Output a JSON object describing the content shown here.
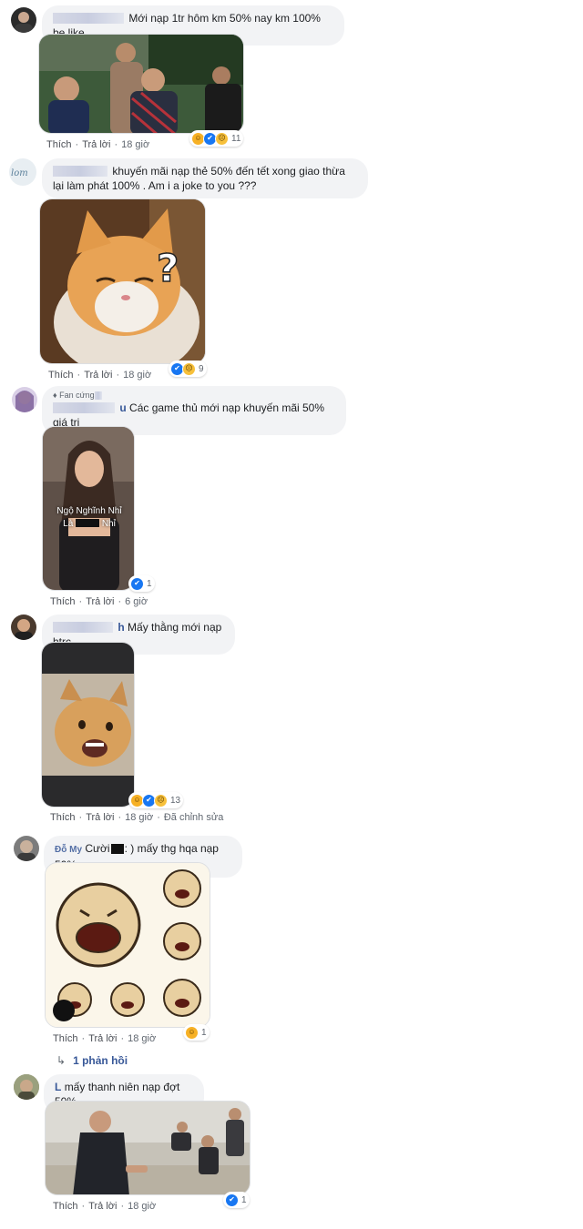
{
  "action_labels": {
    "like": "Thích",
    "reply": "Trả lời",
    "dot": "·"
  },
  "comments": [
    {
      "name": "",
      "text": "Mới nạp 1tr hôm km 50% nay km 100% be like",
      "time": "18 giờ",
      "reaction_count": "11",
      "reactions": [
        "haha-icon",
        "like-icon",
        "sad-icon"
      ]
    },
    {
      "name": "",
      "text": "khuyến mãi nạp thẻ 50% đến tết xong giao thừa lại làm phát 100% . Am i a joke to you ???",
      "time": "18 giờ",
      "reaction_count": "9",
      "reactions": [
        "like-icon",
        "sad-icon"
      ]
    },
    {
      "badge": "Fan cứng",
      "name": "u",
      "text": "Các game thủ mới nạp khuyến mãi 50% giá trị",
      "time": "6 giờ",
      "reaction_count": "1",
      "reactions": [
        "like-icon"
      ],
      "media_caption": [
        "Ngộ Nghĩnh Nhỉ",
        "Là",
        "Nhỉ"
      ]
    },
    {
      "name": "h",
      "text": "Mấy thằng mới nạp htrc",
      "time": "18 giờ",
      "edited": "Đã chỉnh sửa",
      "reaction_count": "13",
      "reactions": [
        "haha-icon",
        "like-icon",
        "sad-icon"
      ]
    },
    {
      "name": "Đỗ My",
      "text": "Cười",
      "text2": ": ) mấy thg hqa nạp 50%",
      "time": "18 giờ",
      "reaction_count": "1",
      "reactions": [
        "haha-icon"
      ],
      "replies_label": "1 phản hồi"
    },
    {
      "name": "L",
      "text": "mấy thanh niên nạp đợt 50%",
      "time": "18 giờ",
      "reaction_count": "1",
      "reactions": [
        "like-icon"
      ]
    }
  ],
  "colors": {
    "bubble": "#f2f3f5",
    "name": "#385898",
    "meta": "#606770",
    "like": "#1877f2",
    "haha": "#f7b125"
  }
}
